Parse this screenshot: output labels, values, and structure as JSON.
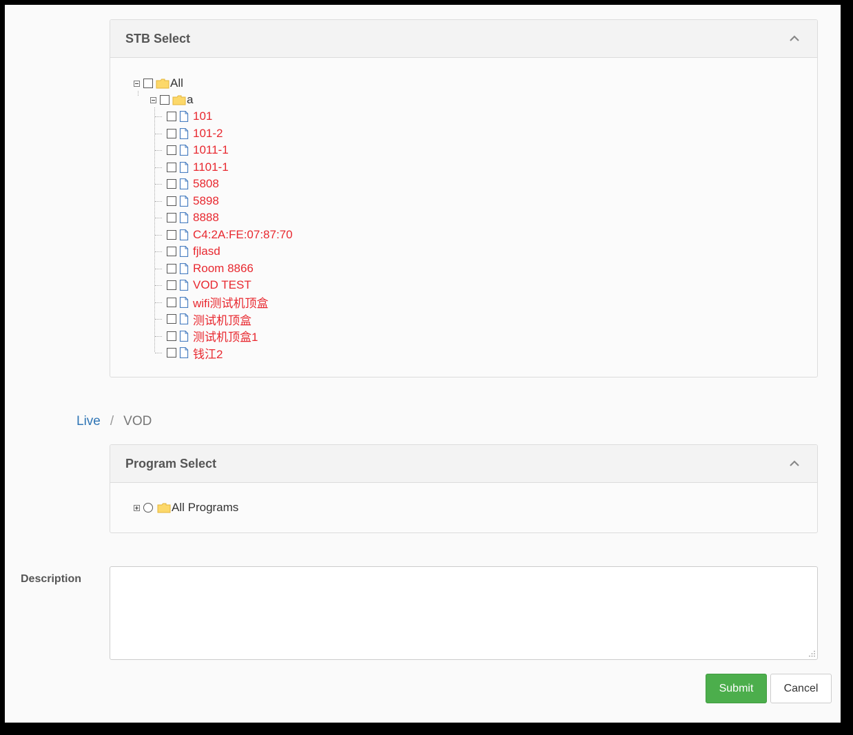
{
  "stb_panel": {
    "title": "STB Select",
    "root": {
      "label": "All",
      "expanded": true
    },
    "group": {
      "label": "a",
      "expanded": true
    },
    "items": [
      "101",
      "101-2",
      "1011-1",
      "1101-1",
      "5808",
      "5898",
      "8888",
      "C4:2A:FE:07:87:70",
      "fjlasd",
      "Room 8866",
      "VOD TEST",
      "wifi测试机顶盒",
      "测试机顶盒",
      "测试机顶盒1",
      "钱江2"
    ],
    "item_color": "#e8282f"
  },
  "breadcrumb": {
    "link": "Live",
    "separator": "/",
    "current": "VOD"
  },
  "program_panel": {
    "title": "Program Select",
    "root": {
      "label": "All Programs",
      "expanded": false
    }
  },
  "description": {
    "label": "Description",
    "value": ""
  },
  "buttons": {
    "submit": "Submit",
    "cancel": "Cancel",
    "submit_color": "#4cae4c"
  },
  "icons": {
    "collapse": "chevron-up-icon",
    "folder": "folder-icon",
    "file": "file-icon",
    "expand": "tree-expand-icon",
    "collapse_tree": "tree-collapse-icon"
  }
}
